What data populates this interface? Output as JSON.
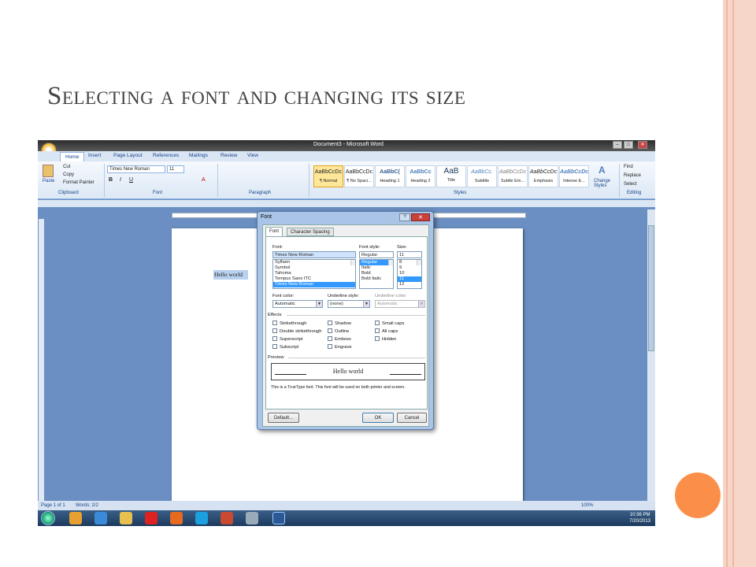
{
  "slide": {
    "title": "Selecting a font and changing its size",
    "colors": {
      "accent_dot": "#fb8f4a",
      "border": "#f6d6c8"
    }
  },
  "window": {
    "title": "Document3 - Microsoft Word",
    "controls": [
      "–",
      "□",
      "✕"
    ]
  },
  "ribbon": {
    "tabs": [
      "Home",
      "Insert",
      "Page Layout",
      "References",
      "Mailings",
      "Review",
      "View"
    ],
    "active_tab": "Home",
    "clipboard": {
      "paste": "Paste",
      "cut": "Cut",
      "copy": "Copy",
      "format_painter": "Format Painter",
      "group": "Clipboard"
    },
    "font": {
      "name": "Times New Roman",
      "size": "11",
      "group": "Font"
    },
    "paragraph": {
      "group": "Paragraph"
    },
    "styles": {
      "items": [
        {
          "preview": "AaBbCcDc",
          "name": "¶ Normal"
        },
        {
          "preview": "AaBbCcDc",
          "name": "¶ No Spaci..."
        },
        {
          "preview": "AaBbC(",
          "name": "Heading 1"
        },
        {
          "preview": "AaBbCc",
          "name": "Heading 2"
        },
        {
          "preview": "AaB",
          "name": "Title"
        },
        {
          "preview": "AaBbCc.",
          "name": "Subtitle"
        },
        {
          "preview": "AaBbCcDc",
          "name": "Subtle Em..."
        },
        {
          "preview": "AaBbCcDc",
          "name": "Emphasis"
        },
        {
          "preview": "AaBbCcDc",
          "name": "Intense E..."
        }
      ],
      "change_styles": "Change Styles",
      "group": "Styles"
    },
    "editing": {
      "find": "Find",
      "replace": "Replace",
      "select": "Select",
      "group": "Editing"
    }
  },
  "document": {
    "text": "Hello world"
  },
  "status": {
    "page": "Page 1 of 1",
    "words": "Words: 2/2",
    "zoom": "100%"
  },
  "taskbar": {
    "time": "10:36 PM",
    "date": "7/20/2013"
  },
  "dialog": {
    "title": "Font",
    "help": "?",
    "close": "✕",
    "tabs": [
      "Font",
      "Character Spacing"
    ],
    "font_label": "Font:",
    "font_value": "Times New Roman",
    "font_list": [
      "Sylfaen",
      "Symbol",
      "Tahoma",
      "Tempus Sans ITC",
      "Times New Roman"
    ],
    "style_label": "Font style:",
    "style_value": "Regular",
    "style_list": [
      "Regular",
      "Italic",
      "Bold",
      "Bold Italic"
    ],
    "size_label": "Size:",
    "size_value": "11",
    "size_list": [
      "8",
      "9",
      "10",
      "11",
      "12"
    ],
    "font_color_label": "Font color:",
    "font_color_value": "Automatic",
    "underline_style_label": "Underline style:",
    "underline_style_value": "(none)",
    "underline_color_label": "Underline color:",
    "underline_color_value": "Automatic",
    "effects_label": "Effects",
    "effects_col1": [
      "Strikethrough",
      "Double strikethrough",
      "Superscript",
      "Subscript"
    ],
    "effects_col2": [
      "Shadow",
      "Outline",
      "Emboss",
      "Engrave"
    ],
    "effects_col3": [
      "Small caps",
      "All caps",
      "Hidden"
    ],
    "preview_label": "Preview",
    "preview_text": "Hello world",
    "preview_note": "This is a TrueType font. This font will be used on both printer and screen.",
    "default_button": "Default...",
    "ok_button": "OK",
    "cancel_button": "Cancel"
  }
}
